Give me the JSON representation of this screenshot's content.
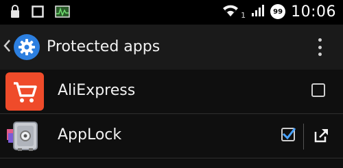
{
  "status_bar": {
    "time": "10:06",
    "network_sub": "1",
    "battery_level": "99",
    "icons": [
      "lock-icon",
      "square-icon",
      "activity-monitor-icon",
      "wifi-icon",
      "signal-icon",
      "battery-icon"
    ]
  },
  "action_bar": {
    "title": "Protected apps",
    "icons": [
      "back-chevron-icon",
      "settings-gear-icon",
      "overflow-menu-icon"
    ]
  },
  "apps": [
    {
      "name": "AliExpress",
      "checked": false,
      "icon": "aliexpress-cart-icon",
      "color": "#ef4b2a"
    },
    {
      "name": "AppLock",
      "checked": true,
      "icon": "applock-safe-icon",
      "has_open_action": true
    }
  ],
  "colors": {
    "accent": "#2c7fe0",
    "check_accent": "#4aa3ff"
  }
}
